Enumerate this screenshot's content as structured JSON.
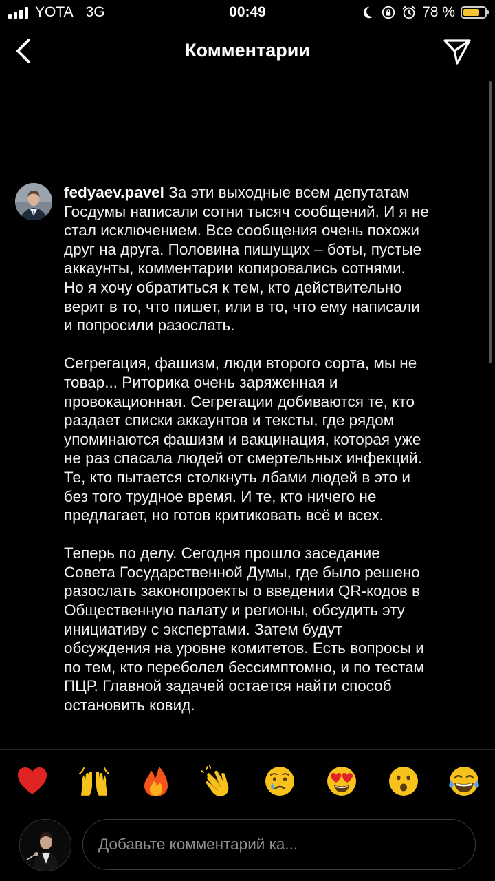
{
  "status_bar": {
    "carrier": "YOTA",
    "network": "3G",
    "time": "00:49",
    "battery_percent": "78 %",
    "battery_level": 0.78,
    "icons": [
      "moon-icon",
      "orientation-lock-icon",
      "alarm-icon"
    ]
  },
  "header": {
    "title": "Комментарии",
    "back_icon": "chevron-left-icon",
    "send_icon": "paper-plane-icon"
  },
  "comment": {
    "username": "fedyaev.pavel",
    "paragraphs": [
      [
        " За эти выходные всем депутатам",
        "Госдумы написали сотни тысяч сообщений. И я не",
        "стал исключением. Все сообщения очень похожи",
        "друг на друга. Половина пишущих – боты, пустые",
        "аккаунты, комментарии копировались сотнями.",
        "Но я хочу обратиться к тем, кто действительно",
        "верит в то, что пишет, или в то, что ему написали",
        "и попросили разослать."
      ],
      [
        "Сегрегация, фашизм, люди второго сорта, мы не",
        "товар... Риторика очень заряженная и",
        "провокационная. Сегрегации добиваются те, кто",
        "раздает списки аккаунтов и тексты, где рядом",
        "упоминаются фашизм и вакцинация, которая уже",
        "не раз спасала людей от смертельных инфекций.",
        "Те, кто пытается столкнуть лбами людей в это и",
        "без того трудное время. И те, кто ничего не",
        "предлагает, но готов критиковать всё и всех."
      ],
      [
        "Теперь по делу. Сегодня прошло заседание",
        "Совета Государственной Думы, где было решено",
        "разослать законопроекты о введении QR-кодов в",
        "Общественную палату и регионы, обсудить эту",
        "инициативу с экспертами. Затем будут",
        "обсуждения на уровне комитетов. Есть вопросы и",
        "по тем, кто переболел бессимптомно, и по тестам",
        "ПЦР. Главной задачей остается найти способ",
        "остановить ковид."
      ]
    ]
  },
  "reactions": [
    {
      "name": "heart",
      "glyph": "❤️"
    },
    {
      "name": "raising-hands",
      "glyph": "🙌"
    },
    {
      "name": "fire",
      "glyph": "🔥"
    },
    {
      "name": "clapping-hands",
      "glyph": "👏"
    },
    {
      "name": "crying-face",
      "glyph": "😢"
    },
    {
      "name": "heart-eyes",
      "glyph": "😍"
    },
    {
      "name": "surprised-face",
      "glyph": "😮"
    },
    {
      "name": "laughing-face",
      "glyph": "😂"
    }
  ],
  "composer": {
    "placeholder": "Добавьте комментарий ка..."
  },
  "colors": {
    "background": "#000000",
    "text": "#f2f2f2",
    "placeholder": "#8e8e8e",
    "divider": "#262626",
    "battery": "#f4c430"
  }
}
